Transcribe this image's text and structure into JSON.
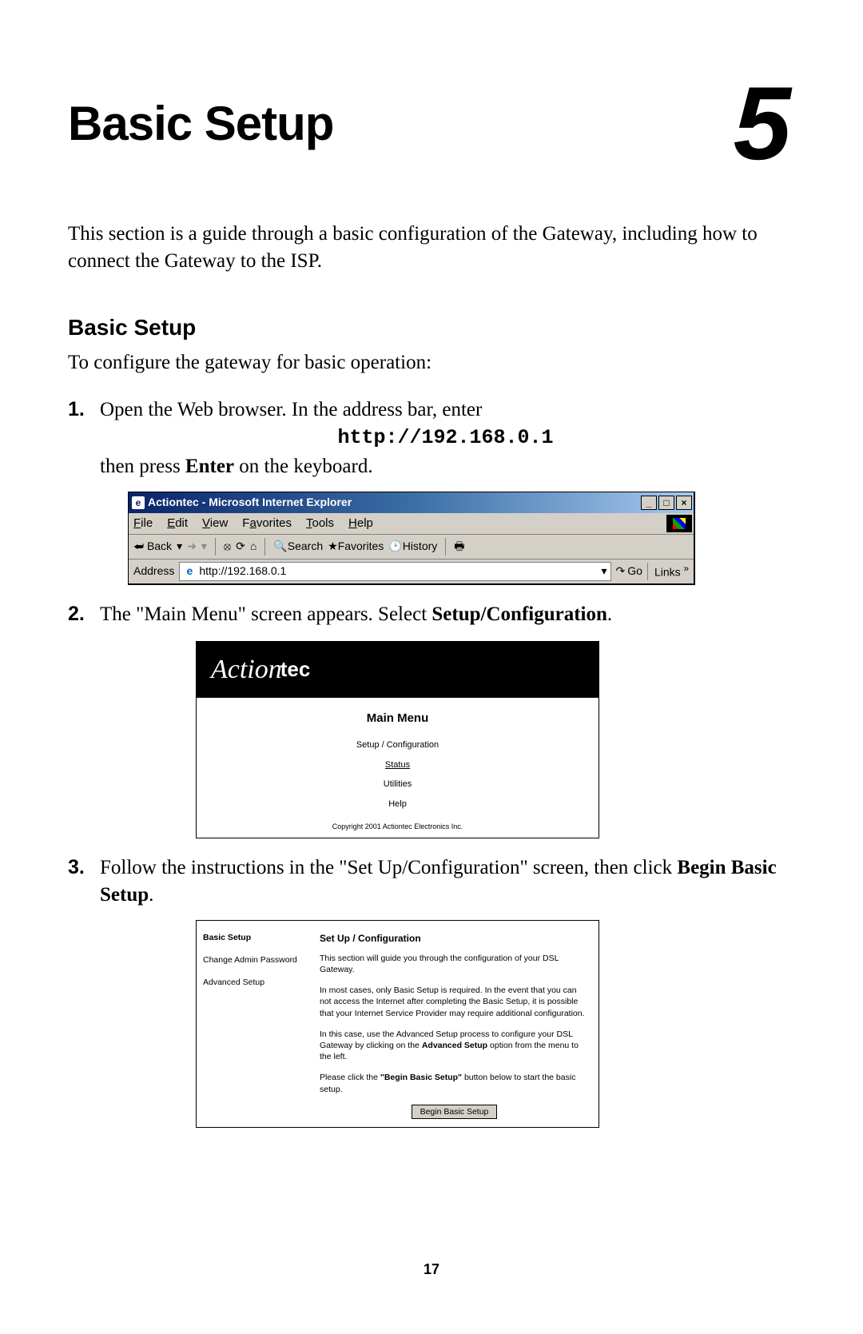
{
  "chapter": {
    "title": "Basic Setup",
    "number": "5"
  },
  "intro": "This section is a guide through a basic configuration of the Gateway, including how to connect the Gateway to the ISP.",
  "section_heading": "Basic Setup",
  "section_lead": "To configure the gateway for basic operation:",
  "step1": {
    "line1": "Open the Web browser. In the address bar, enter",
    "url": "http://192.168.0.1",
    "line2a": "then press ",
    "line2b": "Enter",
    "line2c": " on the keyboard."
  },
  "ie": {
    "title": "Actiontec - Microsoft Internet Explorer",
    "menu": {
      "file": "File",
      "edit": "Edit",
      "view": "View",
      "favorites": "Favorites",
      "tools": "Tools",
      "help": "Help"
    },
    "toolbar": {
      "back": "Back",
      "search": "Search",
      "favorites": "Favorites",
      "history": "History"
    },
    "address_label": "Address",
    "address_value": "http://192.168.0.1",
    "go": "Go",
    "links": "Links"
  },
  "step2": {
    "a": "The \"Main Menu\" screen appears. Select ",
    "b": "Setup/Configuration",
    "c": "."
  },
  "mainmenu": {
    "brand_script": "Action",
    "brand_bold": "tec",
    "title": "Main Menu",
    "items": [
      "Setup / Configuration",
      "Status",
      "Utilities",
      "Help"
    ],
    "copyright": "Copyright 2001 Actiontec Electronics Inc."
  },
  "step3": {
    "a": "Follow the instructions in the \"Set Up/Configuration\" screen, then click ",
    "b": "Begin Basic Setup",
    "c": "."
  },
  "cfg": {
    "side": {
      "basic": "Basic Setup",
      "change": "Change Admin Password",
      "advanced": "Advanced Setup"
    },
    "heading": "Set Up / Configuration",
    "p1": "This section will guide you through the configuration of your DSL Gateway.",
    "p2a": "In most cases, only Basic Setup is required. In the event that you can not access the Internet after completing the Basic Setup, it is possible that your Internet Service Provider may require additional configuration.",
    "p3a": "In this case, use the Advanced Setup process to configure your DSL Gateway by clicking on the ",
    "p3b": "Advanced Setup",
    "p3c": " option from the menu to the left.",
    "p4a": "Please click the ",
    "p4b": "\"Begin Basic Setup\"",
    "p4c": " button below to start the basic setup.",
    "button": "Begin Basic Setup"
  },
  "page_number": "17"
}
